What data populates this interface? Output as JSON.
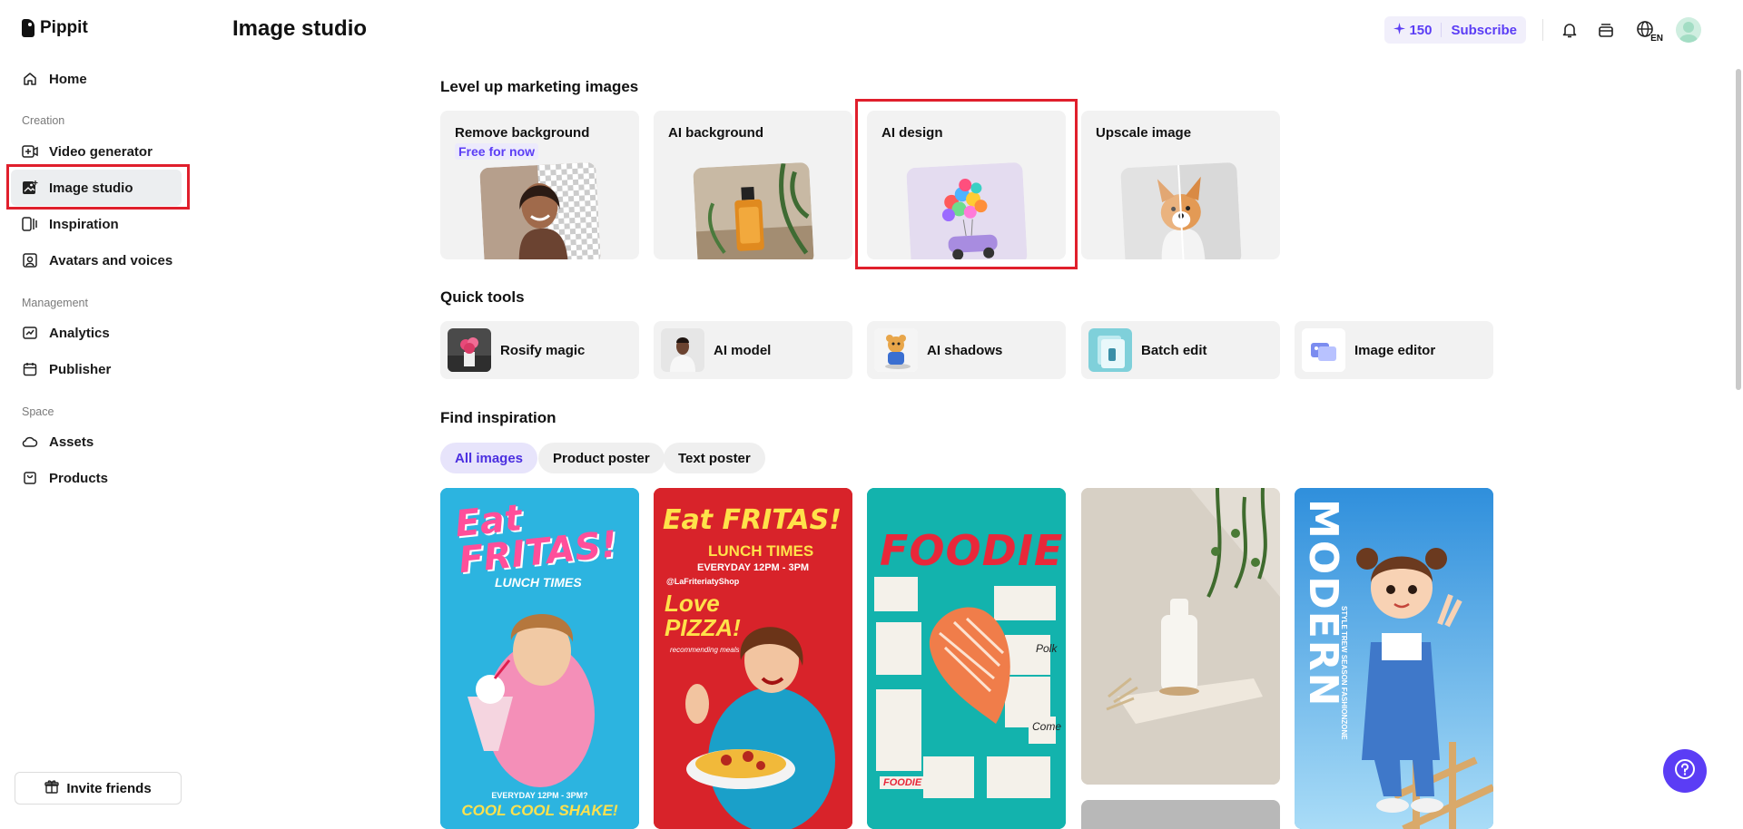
{
  "app": {
    "name": "Pippit"
  },
  "sidebar": {
    "home": "Home",
    "sections": {
      "creation": "Creation",
      "management": "Management",
      "space": "Space"
    },
    "items": {
      "video_generator": "Video generator",
      "image_studio": "Image studio",
      "inspiration": "Inspiration",
      "avatars_voices": "Avatars and voices",
      "analytics": "Analytics",
      "publisher": "Publisher",
      "assets": "Assets",
      "products": "Products"
    },
    "invite_label": "Invite friends"
  },
  "header": {
    "title": "Image studio",
    "credits": "150",
    "subscribe": "Subscribe",
    "language": "EN"
  },
  "marketing": {
    "title": "Level up marketing images",
    "cards": [
      {
        "title": "Remove background",
        "badge": "Free for now"
      },
      {
        "title": "AI background"
      },
      {
        "title": "AI design"
      },
      {
        "title": "Upscale image"
      }
    ]
  },
  "quick_tools": {
    "title": "Quick tools",
    "items": [
      "Rosify magic",
      "AI model",
      "AI shadows",
      "Batch edit",
      "Image editor"
    ]
  },
  "inspiration": {
    "title": "Find inspiration",
    "filters": [
      "All images",
      "Product poster",
      "Text poster"
    ],
    "active_filter": "All images",
    "posters": [
      {
        "headline": "Eat FRITAS!",
        "sub": "LUNCH TIMES",
        "footer1": "EVERYDAY 12PM - 3PM?",
        "footer2": "COOL COOL SHAKE!"
      },
      {
        "headline": "Eat FRITAS!",
        "sub": "LUNCH TIMES",
        "line": "EVERYDAY 12PM - 3PM",
        "handle": "@LaFriteriatyShop",
        "promo": "Love PIZZA!",
        "promo_sub": "recommending meals"
      },
      {
        "headline": "FOODIE",
        "tag": "FOODIE",
        "note1": "Polk",
        "note2": "Come"
      },
      {
        "headline": ""
      },
      {
        "headline": "MODERN",
        "sub": "STYLE TREW SEASON FASHIONZONE"
      }
    ]
  },
  "colors": {
    "accent": "#5b3df5",
    "highlight": "#e01f2c",
    "card_bg": "#f2f2f2"
  }
}
